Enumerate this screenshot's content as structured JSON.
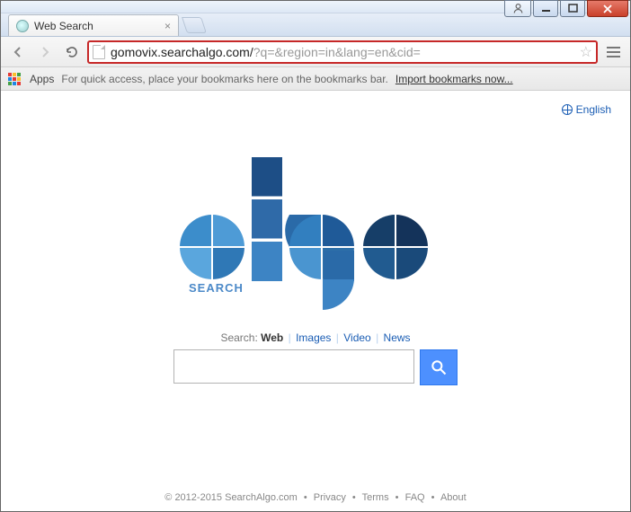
{
  "window": {
    "tab_title": "Web Search"
  },
  "toolbar": {
    "url_domain": "gomovix.searchalgo.com/",
    "url_rest": "?q=&region=in&lang=en&cid="
  },
  "bookmarks": {
    "apps_label": "Apps",
    "hint": "For quick access, place your bookmarks here on the bookmarks bar.",
    "import_link": "Import bookmarks now..."
  },
  "page": {
    "language_label": "English",
    "logo_search_text": "SEARCH",
    "search": {
      "label_prefix": "Search:",
      "tabs": [
        "Web",
        "Images",
        "Video",
        "News"
      ],
      "active_tab": "Web",
      "input_value": ""
    },
    "footer": {
      "copyright": "© 2012-2015 SearchAlgo.com",
      "links": [
        "Privacy",
        "Terms",
        "FAQ",
        "About"
      ]
    }
  }
}
